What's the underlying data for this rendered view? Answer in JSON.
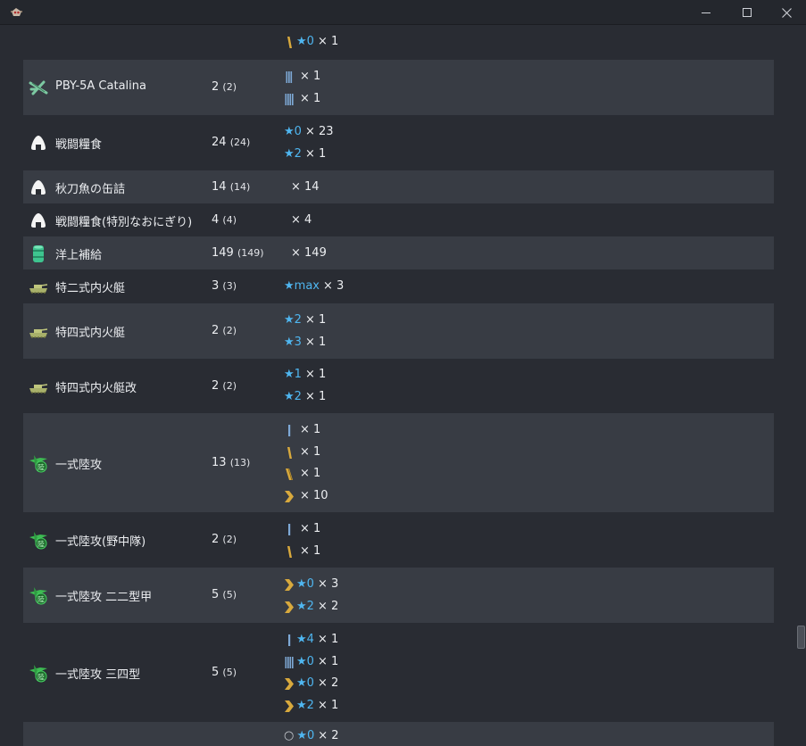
{
  "window": {
    "controls": {
      "minimize": "minimize",
      "maximize": "maximize",
      "close": "close"
    }
  },
  "rows": [
    {
      "name": "",
      "count": "",
      "count_sub": "",
      "icon": "none",
      "details": [
        {
          "prof": "single-yellow",
          "star": "★0",
          "mult": "× 1"
        }
      ]
    },
    {
      "name": "PBY-5A Catalina",
      "count": "2",
      "count_sub": "(2)",
      "icon": "seaplane-icon",
      "details": [
        {
          "prof": "triple-blue",
          "star": "",
          "mult": "× 1"
        },
        {
          "prof": "quad-blue",
          "star": "",
          "mult": "× 1"
        }
      ]
    },
    {
      "name": "戦闘糧食",
      "count": "24",
      "count_sub": "(24)",
      "icon": "onigiri-icon",
      "details": [
        {
          "prof": "none",
          "star": "★0",
          "mult": "× 23"
        },
        {
          "prof": "none",
          "star": "★2",
          "mult": "× 1"
        }
      ]
    },
    {
      "name": "秋刀魚の缶詰",
      "count": "14",
      "count_sub": "(14)",
      "icon": "onigiri-icon",
      "details": [
        {
          "prof": "none",
          "star": "",
          "mult": "× 14"
        }
      ]
    },
    {
      "name": "戦闘糧食(特別なおにぎり)",
      "count": "4",
      "count_sub": "(4)",
      "icon": "onigiri-icon",
      "details": [
        {
          "prof": "none",
          "star": "",
          "mult": "× 4"
        }
      ]
    },
    {
      "name": "洋上補給",
      "count": "149",
      "count_sub": "(149)",
      "icon": "drum-icon",
      "details": [
        {
          "prof": "none",
          "star": "",
          "mult": "× 149"
        }
      ]
    },
    {
      "name": "特二式内火艇",
      "count": "3",
      "count_sub": "(3)",
      "icon": "tank-icon",
      "details": [
        {
          "prof": "none",
          "star": "★max",
          "mult": "× 3"
        }
      ]
    },
    {
      "name": "特四式内火艇",
      "count": "2",
      "count_sub": "(2)",
      "icon": "tank-icon",
      "details": [
        {
          "prof": "none",
          "star": "★2",
          "mult": "× 1"
        },
        {
          "prof": "none",
          "star": "★3",
          "mult": "× 1"
        }
      ]
    },
    {
      "name": "特四式内火艇改",
      "count": "2",
      "count_sub": "(2)",
      "icon": "tank-icon",
      "details": [
        {
          "prof": "none",
          "star": "★1",
          "mult": "× 1"
        },
        {
          "prof": "none",
          "star": "★2",
          "mult": "× 1"
        }
      ]
    },
    {
      "name": "一式陸攻",
      "count": "13",
      "count_sub": "(13)",
      "icon": "land-bomber-icon",
      "details": [
        {
          "prof": "single-blue",
          "star": "",
          "mult": "× 1"
        },
        {
          "prof": "single-yellow",
          "star": "",
          "mult": "× 1"
        },
        {
          "prof": "double-yellow",
          "star": "",
          "mult": "× 1"
        },
        {
          "prof": "chevron-yellow",
          "star": "",
          "mult": "× 10"
        }
      ]
    },
    {
      "name": "一式陸攻(野中隊)",
      "count": "2",
      "count_sub": "(2)",
      "icon": "land-bomber-icon",
      "details": [
        {
          "prof": "single-blue",
          "star": "",
          "mult": "× 1"
        },
        {
          "prof": "single-yellow",
          "star": "",
          "mult": "× 1"
        }
      ]
    },
    {
      "name": "一式陸攻 二二型甲",
      "count": "5",
      "count_sub": "(5)",
      "icon": "land-bomber-icon",
      "details": [
        {
          "prof": "chevron-yellow",
          "star": "★0",
          "mult": "× 3"
        },
        {
          "prof": "chevron-yellow",
          "star": "★2",
          "mult": "× 2"
        }
      ]
    },
    {
      "name": "一式陸攻 三四型",
      "count": "5",
      "count_sub": "(5)",
      "icon": "land-bomber-icon",
      "details": [
        {
          "prof": "single-blue",
          "star": "★4",
          "mult": "× 1"
        },
        {
          "prof": "quad-blue",
          "star": "★0",
          "mult": "× 1"
        },
        {
          "prof": "chevron-yellow",
          "star": "★0",
          "mult": "× 2"
        },
        {
          "prof": "chevron-yellow",
          "star": "★2",
          "mult": "× 1"
        }
      ]
    },
    {
      "name": "",
      "count": "",
      "count_sub": "",
      "icon": "none",
      "details": [
        {
          "prof": "circle",
          "star": "★0",
          "mult": "× 2"
        }
      ]
    }
  ]
}
